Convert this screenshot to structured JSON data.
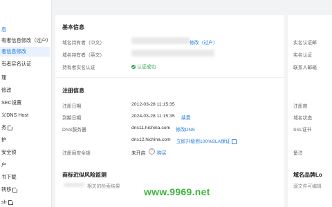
{
  "sidebar": {
    "items": [
      {
        "label": "息",
        "style": "blue"
      },
      {
        "label": "有者信息修改（过户）",
        "style": "normal"
      },
      {
        "label": "者信息修改",
        "style": "active"
      },
      {
        "label": "有者实名认证",
        "style": "normal"
      },
      {
        "label": "理",
        "style": "normal"
      },
      {
        "label": "修改",
        "style": "normal"
      },
      {
        "label": "SEC设置",
        "style": "normal"
      },
      {
        "label": "义DNS Host",
        "style": "normal"
      },
      {
        "label": "务",
        "style": "ext"
      },
      {
        "label": "护",
        "style": "normal"
      },
      {
        "label": "安全锁",
        "style": "normal"
      },
      {
        "label": "户",
        "style": "normal"
      },
      {
        "label": "书下载",
        "style": "normal"
      },
      {
        "label": "转移",
        "style": "ext"
      },
      {
        "label": "sh",
        "style": "ext"
      }
    ]
  },
  "basic": {
    "title": "基本信息",
    "holder_cn_label": "域名持有者（中文）",
    "holder_cn_action": "修改（过户）",
    "holder_en_label": "域名持有者（英文）",
    "realname_label": "持有者实名认证",
    "realname_status": "认证成功"
  },
  "register": {
    "title": "注册信息",
    "reg_date_label": "注册日期",
    "reg_date": "2012-03-28 11:15:35",
    "expire_label": "到期日期",
    "expire_date": "2024-03-28 11:15:35",
    "renew": "续费",
    "dns_label": "DNS服务器",
    "dns1": "dns11.hichina.com",
    "dns_modify": "修改DNS",
    "dns2": "dns12.hichina.com",
    "upgrade": "立即升级到100%SLA保证",
    "lock_label": "注册局安全锁",
    "lock_status": "未开启",
    "lock_link": "购买"
  },
  "right_panel": {
    "realname_email": "实名认证邮",
    "realname_status_lbl": "实名认证",
    "contact_email": "联系人邮箱",
    "registrar": "注册商",
    "domain_status": "域名状态",
    "ssl": "SSL证书",
    "note": "备注"
  },
  "bottom": {
    "monitor_title": "商标近似风险监测",
    "monitor_sub": "相关的检索结果",
    "brand_title": "域名品牌Lo",
    "brand_sub": "源文件可编辑"
  },
  "watermark": "www.9969.net"
}
